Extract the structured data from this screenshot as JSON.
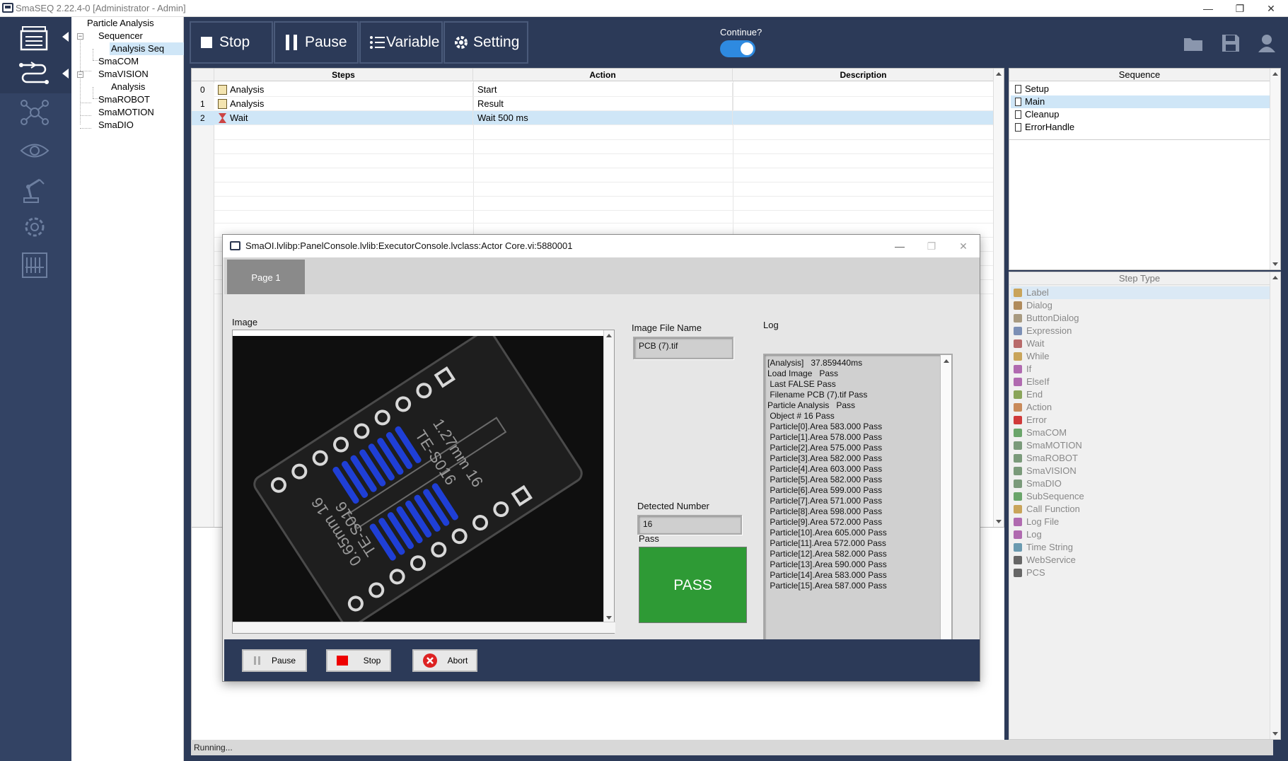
{
  "window": {
    "title": "SmaSEQ 2.22.4-0 [Administrator - Admin]",
    "controls": [
      "—",
      "❐",
      "✕"
    ]
  },
  "rail": {
    "icons": [
      "folder-panel-icon",
      "sequence-flow-icon",
      "network-icon",
      "vision-eye-icon",
      "robot-arm-icon",
      "motion-gear-icon",
      "dio-board-icon"
    ]
  },
  "tree": {
    "nodes": [
      {
        "label": "Particle Analysis",
        "level": 0
      },
      {
        "label": "Sequencer",
        "level": 1
      },
      {
        "label": "Analysis Seq",
        "level": 2
      },
      {
        "label": "SmaCOM",
        "level": 1
      },
      {
        "label": "SmaVISION",
        "level": 1
      },
      {
        "label": "Analysis",
        "level": 2
      },
      {
        "label": "SmaROBOT",
        "level": 1
      },
      {
        "label": "SmaMOTION",
        "level": 1
      },
      {
        "label": "SmaDIO",
        "level": 1
      }
    ]
  },
  "toolbar": {
    "stop_label": "Stop",
    "pause_label": "Pause",
    "variable_label": "Variable",
    "setting_label": "Setting",
    "continue_label": "Continue?",
    "continue_on": true
  },
  "steps": {
    "headers": [
      "Steps",
      "Action",
      "Description"
    ],
    "rows": [
      {
        "num": "0",
        "icon": "analysis-icon",
        "step": "Analysis",
        "action": "Start",
        "description": ""
      },
      {
        "num": "1",
        "icon": "analysis-icon",
        "step": "Analysis",
        "action": "Result",
        "description": ""
      },
      {
        "num": "2",
        "icon": "hourglass-icon",
        "step": "Wait",
        "action": "Wait 500 ms",
        "description": ""
      }
    ]
  },
  "sequence": {
    "header": "Sequence",
    "items": [
      "Setup",
      "Main",
      "Cleanup",
      "ErrorHandle"
    ],
    "selected": "Main"
  },
  "step_type": {
    "header": "Step Type",
    "items": [
      {
        "label": "Label",
        "color": "#c9a45a"
      },
      {
        "label": "Dialog",
        "color": "#b08b5c"
      },
      {
        "label": "ButtonDialog",
        "color": "#a89a80"
      },
      {
        "label": "Expression",
        "color": "#7b8fb5"
      },
      {
        "label": "Wait",
        "color": "#b86a6a"
      },
      {
        "label": "While",
        "color": "#c9a45a"
      },
      {
        "label": "If",
        "color": "#b06ab0"
      },
      {
        "label": "ElseIf",
        "color": "#b06ab0"
      },
      {
        "label": "End",
        "color": "#8aa55a"
      },
      {
        "label": "Action",
        "color": "#c98a5a"
      },
      {
        "label": "Error",
        "color": "#d03a3a"
      },
      {
        "label": "SmaCOM",
        "color": "#6aa56a"
      },
      {
        "label": "SmaMOTION",
        "color": "#7a9a7a"
      },
      {
        "label": "SmaROBOT",
        "color": "#7a9a7a"
      },
      {
        "label": "SmaVISION",
        "color": "#7a9a7a"
      },
      {
        "label": "SmaDIO",
        "color": "#7a9a7a"
      },
      {
        "label": "SubSequence",
        "color": "#6aa56a"
      },
      {
        "label": "Call Function",
        "color": "#c9a45a"
      },
      {
        "label": "Log File",
        "color": "#b06ab0"
      },
      {
        "label": "Log",
        "color": "#b06ab0"
      },
      {
        "label": "Time String",
        "color": "#6a9ab0"
      },
      {
        "label": "WebService",
        "color": "#666666"
      },
      {
        "label": "PCS",
        "color": "#666666"
      }
    ],
    "selected": "Label"
  },
  "status": {
    "text": "Running..."
  },
  "dialog": {
    "title": "SmaOI.lvlibp:PanelConsole.lvlib:ExecutorConsole.lvclass:Actor Core.vi:5880001",
    "tab": "Page 1",
    "image_label": "Image",
    "image_file_label": "Image File Name",
    "image_file_value": "PCB (7).tif",
    "detected_label": "Detected Number",
    "detected_value": "16",
    "pass_label": "Pass",
    "pass_value": "PASS",
    "log_label": "Log",
    "log_lines": [
      "[Analysis]   37.859440ms",
      "Load Image   Pass",
      " Last FALSE Pass",
      " Filename PCB (7).tif Pass",
      "Particle Analysis   Pass",
      " Object # 16 Pass",
      " Particle[0].Area 583.000 Pass",
      " Particle[1].Area 578.000 Pass",
      " Particle[2].Area 575.000 Pass",
      " Particle[3].Area 582.000 Pass",
      " Particle[4].Area 603.000 Pass",
      " Particle[5].Area 582.000 Pass",
      " Particle[6].Area 599.000 Pass",
      " Particle[7].Area 571.000 Pass",
      " Particle[8].Area 598.000 Pass",
      " Particle[9].Area 572.000 Pass",
      " Particle[10].Area 605.000 Pass",
      " Particle[11].Area 572.000 Pass",
      " Particle[12].Area 582.000 Pass",
      " Particle[13].Area 590.000 Pass",
      " Particle[14].Area 583.000 Pass",
      " Particle[15].Area 587.000 Pass"
    ],
    "pcb_text_1": "1.27mm 16",
    "pcb_text_2": "TE-S016",
    "pcb_text_3": "0.65mm 16",
    "pcb_text_4": "TE-S016",
    "footer": {
      "pause_label": "Pause",
      "stop_label": "Stop",
      "abort_label": "Abort"
    },
    "colors": {
      "pass": "#2e9a35",
      "particle": "#1f3fd6"
    }
  },
  "colors": {
    "chrome": "#2c3a58",
    "selection": "#cfe6f7",
    "toggle": "#2e8ae0"
  }
}
